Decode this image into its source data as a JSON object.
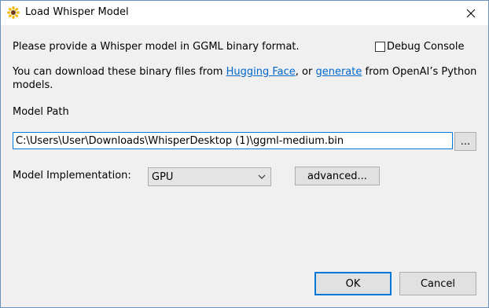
{
  "window": {
    "title": "Load Whisper Model",
    "app_icon": "sunflower-icon",
    "close_icon": "close-icon"
  },
  "intro": {
    "line1": "Please provide a Whisper model in GGML binary format.",
    "line2_prefix": "You can download these binary files from ",
    "link_hugging_face": "Hugging Face",
    "line2_middle": ", or ",
    "link_generate": "generate",
    "line2_suffix": " from OpenAI’s Python",
    "line3": "models."
  },
  "debug_console": {
    "label": "Debug Console",
    "checked": false
  },
  "model_path": {
    "label": "Model Path",
    "value": "C:\\Users\\User\\Downloads\\WhisperDesktop (1)\\ggml-medium.bin",
    "browse_label": "..."
  },
  "implementation": {
    "label": "Model Implementation:",
    "selected": "GPU",
    "advanced_label": "advanced..."
  },
  "buttons": {
    "ok": "OK",
    "cancel": "Cancel"
  },
  "colors": {
    "link": "#0066cc",
    "focus": "#0078d7",
    "background": "#f0f0f0"
  }
}
